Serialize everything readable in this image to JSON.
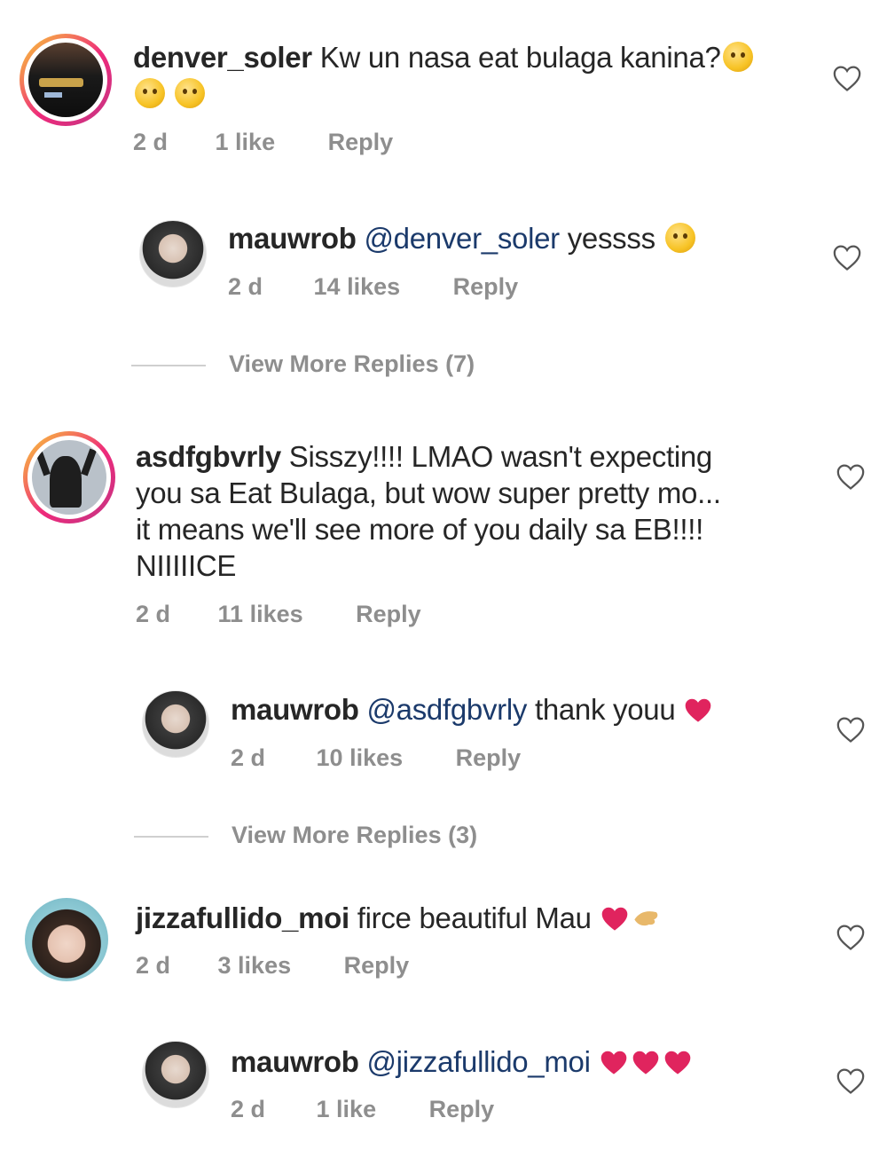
{
  "comments": [
    {
      "username": "denver_soler",
      "text": "Kw un nasa eat bulaga kanina?",
      "time": "2 d",
      "likes": "1 like",
      "reply": "Reply"
    },
    {
      "username": "mauwrob",
      "mention": "@denver_soler",
      "text": "yessss",
      "time": "2 d",
      "likes": "14 likes",
      "reply": "Reply"
    },
    {
      "view_more": "View More Replies (7)"
    },
    {
      "username": "asdfgbvrly",
      "text_line1": "Sisszy!!!! LMAO wasn't expecting",
      "text_line2": "you sa Eat Bulaga, but wow super pretty mo...",
      "text_line3": "it means we'll see more of you daily sa EB!!!!",
      "text_line4": "NIIIIICE",
      "time": "2 d",
      "likes": "11 likes",
      "reply": "Reply"
    },
    {
      "username": "mauwrob",
      "mention": "@asdfgbvrly",
      "text": "thank youu",
      "time": "2 d",
      "likes": "10 likes",
      "reply": "Reply"
    },
    {
      "view_more": "View More Replies (3)"
    },
    {
      "username": "jizzafullido_moi",
      "text": "firce beautiful Mau",
      "time": "2 d",
      "likes": "3 likes",
      "reply": "Reply"
    },
    {
      "username": "mauwrob",
      "mention": "@jizzafullido_moi",
      "text": "",
      "time": "2 d",
      "likes": "1 like",
      "reply": "Reply"
    }
  ],
  "colors": {
    "mention": "#1b3a6b",
    "meta": "#8e8e8e",
    "heart_red": "#e0245e"
  },
  "icons": [
    "heart-outline-icon",
    "smiling-face-icon",
    "heart-emoji-icon",
    "hug-face-icon",
    "kiss-face-icon",
    "hand-emoji-icon"
  ]
}
